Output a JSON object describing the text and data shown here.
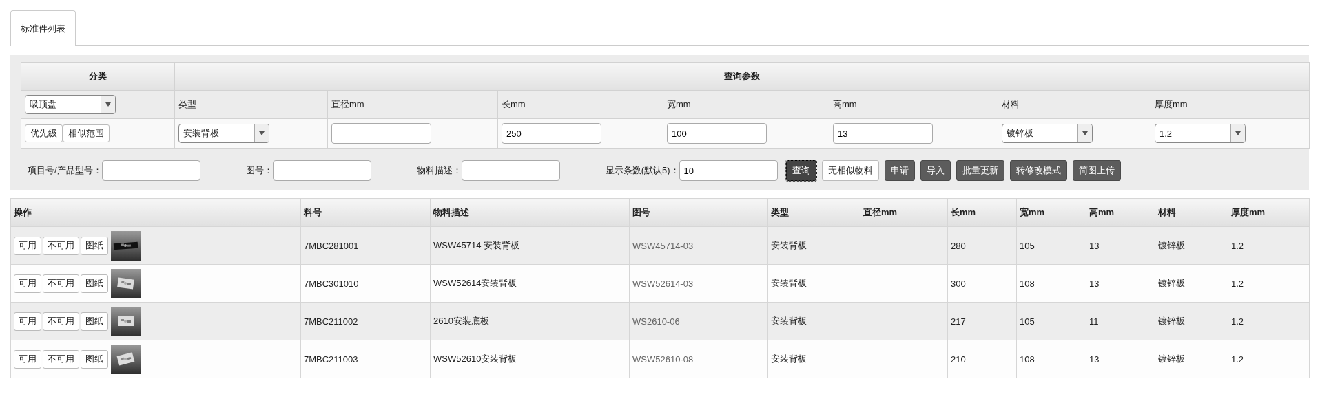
{
  "tabs": [
    {
      "label": "标准件列表",
      "selected": true
    }
  ],
  "filter": {
    "category_header": "分类",
    "params_header": "查询参数",
    "category_select": {
      "value": "吸顶盘"
    },
    "category_buttons": [
      "优先级",
      "相似范围"
    ],
    "params": [
      {
        "label": "类型",
        "kind": "select",
        "value": "安装背板"
      },
      {
        "label": "直径mm",
        "kind": "input"
      },
      {
        "label": "长mm",
        "kind": "input",
        "value": "250"
      },
      {
        "label": "宽mm",
        "kind": "input",
        "value": "100"
      },
      {
        "label": "高mm",
        "kind": "input",
        "value": "13"
      },
      {
        "label": "材料",
        "kind": "select",
        "value": "镀锌板"
      },
      {
        "label": "厚度mm",
        "kind": "select",
        "value": "1.2"
      }
    ],
    "search_fields": [
      {
        "label": "项目号/产品型号："
      },
      {
        "label": "图号："
      },
      {
        "label": "物料描述："
      },
      {
        "label": "显示条数(默认5)：",
        "value": "10"
      }
    ],
    "buttons": [
      {
        "label": "查询",
        "kind": "focused"
      },
      {
        "label": "无相似物料",
        "kind": "light"
      },
      {
        "label": "申请",
        "kind": "dark"
      },
      {
        "label": "导入",
        "kind": "dark"
      },
      {
        "label": "批量更新",
        "kind": "dark"
      },
      {
        "label": "转修改模式",
        "kind": "dark"
      },
      {
        "label": "简图上传",
        "kind": "dark"
      }
    ]
  },
  "table": {
    "columns": [
      "操作",
      "料号",
      "物料描述",
      "图号",
      "类型",
      "直径mm",
      "长mm",
      "宽mm",
      "高mm",
      "材料",
      "厚度mm"
    ],
    "rows": [
      {
        "cells": [
          {
            "actions": [
              "可用",
              "不可用",
              "图纸"
            ],
            "thumbnail": {
              "kind": "picture"
            }
          },
          "7MBC281001",
          "WSW45714 安装背板",
          "WSW45714-03",
          "安装背板",
          "",
          "280",
          "105",
          "13",
          "镀锌板",
          "1.2"
        ]
      },
      {
        "cells": [
          {
            "actions": [
              "可用",
              "不可用",
              "图纸"
            ],
            "thumbnail": {
              "kind": "picture"
            }
          },
          "7MBC301010",
          "WSW52614安装背板",
          "WSW52614-03",
          "安装背板",
          "",
          "300",
          "108",
          "13",
          "镀锌板",
          "1.2"
        ]
      },
      {
        "cells": [
          {
            "actions": [
              "可用",
              "不可用",
              "图纸"
            ],
            "thumbnail": {
              "kind": "picture"
            }
          },
          "7MBC211002",
          "2610安装底板",
          "WS2610-06",
          "安装背板",
          "",
          "217",
          "105",
          "11",
          "镀锌板",
          "1.2"
        ]
      },
      {
        "cells": [
          {
            "actions": [
              "可用",
              "不可用",
              "图纸"
            ],
            "thumbnail": {
              "kind": "picture"
            }
          },
          "7MBC211003",
          "WSW52610安装背板",
          "WSW52610-08",
          "安装背板",
          "",
          "210",
          "108",
          "13",
          "镀锌板",
          "1.2"
        ]
      }
    ]
  }
}
